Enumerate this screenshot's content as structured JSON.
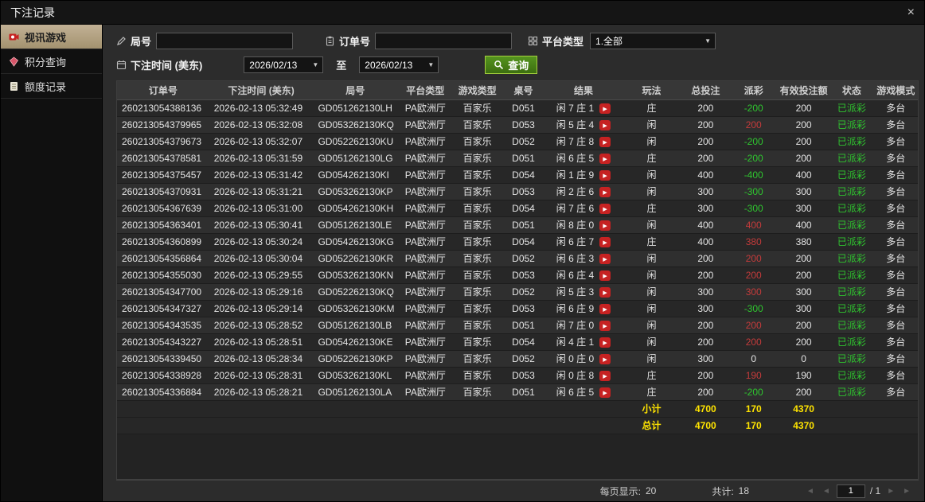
{
  "window": {
    "title": "下注记录"
  },
  "icons": {
    "close": "×",
    "dropdown_arrow": "▼",
    "play": "▶",
    "arrow_left": "◄",
    "arrow_right": "►"
  },
  "sidebar": {
    "items": [
      {
        "label": "视讯游戏"
      },
      {
        "label": "积分查询"
      },
      {
        "label": "额度记录"
      }
    ]
  },
  "filters": {
    "round_label": "局号",
    "round_value": "",
    "order_label": "订单号",
    "order_value": "",
    "platform_label": "平台类型",
    "platform_value": "1.全部",
    "time_label": "下注时间 (美东)",
    "date_from": "2026/02/13",
    "to_label": "至",
    "date_to": "2026/02/13",
    "query_label": "查询"
  },
  "table": {
    "headers": [
      "订单号",
      "下注时间 (美东)",
      "局号",
      "平台类型",
      "游戏类型",
      "桌号",
      "结果",
      "玩法",
      "总投注",
      "派彩",
      "有效投注额",
      "状态",
      "游戏模式"
    ],
    "rows": [
      {
        "order": "260213054388136",
        "time": "2026-02-13 05:32:49",
        "round": "GD051262130LH",
        "platform": "PA欧洲厅",
        "game": "百家乐",
        "table": "D051",
        "result": "闲 7 庄 1",
        "play": "庄",
        "bet": "200",
        "payout": "-200",
        "payout_sign": "neg",
        "valid": "200",
        "status": "已派彩",
        "mode": "多台"
      },
      {
        "order": "260213054379965",
        "time": "2026-02-13 05:32:08",
        "round": "GD053262130KQ",
        "platform": "PA欧洲厅",
        "game": "百家乐",
        "table": "D053",
        "result": "闲 5 庄 4",
        "play": "闲",
        "bet": "200",
        "payout": "200",
        "payout_sign": "pos",
        "valid": "200",
        "status": "已派彩",
        "mode": "多台"
      },
      {
        "order": "260213054379673",
        "time": "2026-02-13 05:32:07",
        "round": "GD052262130KU",
        "platform": "PA欧洲厅",
        "game": "百家乐",
        "table": "D052",
        "result": "闲 7 庄 8",
        "play": "闲",
        "bet": "200",
        "payout": "-200",
        "payout_sign": "neg",
        "valid": "200",
        "status": "已派彩",
        "mode": "多台"
      },
      {
        "order": "260213054378581",
        "time": "2026-02-13 05:31:59",
        "round": "GD051262130LG",
        "platform": "PA欧洲厅",
        "game": "百家乐",
        "table": "D051",
        "result": "闲 6 庄 5",
        "play": "庄",
        "bet": "200",
        "payout": "-200",
        "payout_sign": "neg",
        "valid": "200",
        "status": "已派彩",
        "mode": "多台"
      },
      {
        "order": "260213054375457",
        "time": "2026-02-13 05:31:42",
        "round": "GD054262130KI",
        "platform": "PA欧洲厅",
        "game": "百家乐",
        "table": "D054",
        "result": "闲 1 庄 9",
        "play": "闲",
        "bet": "400",
        "payout": "-400",
        "payout_sign": "neg",
        "valid": "400",
        "status": "已派彩",
        "mode": "多台"
      },
      {
        "order": "260213054370931",
        "time": "2026-02-13 05:31:21",
        "round": "GD053262130KP",
        "platform": "PA欧洲厅",
        "game": "百家乐",
        "table": "D053",
        "result": "闲 2 庄 6",
        "play": "闲",
        "bet": "300",
        "payout": "-300",
        "payout_sign": "neg",
        "valid": "300",
        "status": "已派彩",
        "mode": "多台"
      },
      {
        "order": "260213054367639",
        "time": "2026-02-13 05:31:00",
        "round": "GD054262130KH",
        "platform": "PA欧洲厅",
        "game": "百家乐",
        "table": "D054",
        "result": "闲 7 庄 6",
        "play": "庄",
        "bet": "300",
        "payout": "-300",
        "payout_sign": "neg",
        "valid": "300",
        "status": "已派彩",
        "mode": "多台"
      },
      {
        "order": "260213054363401",
        "time": "2026-02-13 05:30:41",
        "round": "GD051262130LE",
        "platform": "PA欧洲厅",
        "game": "百家乐",
        "table": "D051",
        "result": "闲 8 庄 0",
        "play": "闲",
        "bet": "400",
        "payout": "400",
        "payout_sign": "pos",
        "valid": "400",
        "status": "已派彩",
        "mode": "多台"
      },
      {
        "order": "260213054360899",
        "time": "2026-02-13 05:30:24",
        "round": "GD054262130KG",
        "platform": "PA欧洲厅",
        "game": "百家乐",
        "table": "D054",
        "result": "闲 6 庄 7",
        "play": "庄",
        "bet": "400",
        "payout": "380",
        "payout_sign": "pos",
        "valid": "380",
        "status": "已派彩",
        "mode": "多台"
      },
      {
        "order": "260213054356864",
        "time": "2026-02-13 05:30:04",
        "round": "GD052262130KR",
        "platform": "PA欧洲厅",
        "game": "百家乐",
        "table": "D052",
        "result": "闲 6 庄 3",
        "play": "闲",
        "bet": "200",
        "payout": "200",
        "payout_sign": "pos",
        "valid": "200",
        "status": "已派彩",
        "mode": "多台"
      },
      {
        "order": "260213054355030",
        "time": "2026-02-13 05:29:55",
        "round": "GD053262130KN",
        "platform": "PA欧洲厅",
        "game": "百家乐",
        "table": "D053",
        "result": "闲 6 庄 4",
        "play": "闲",
        "bet": "200",
        "payout": "200",
        "payout_sign": "pos",
        "valid": "200",
        "status": "已派彩",
        "mode": "多台"
      },
      {
        "order": "260213054347700",
        "time": "2026-02-13 05:29:16",
        "round": "GD052262130KQ",
        "platform": "PA欧洲厅",
        "game": "百家乐",
        "table": "D052",
        "result": "闲 5 庄 3",
        "play": "闲",
        "bet": "300",
        "payout": "300",
        "payout_sign": "pos",
        "valid": "300",
        "status": "已派彩",
        "mode": "多台"
      },
      {
        "order": "260213054347327",
        "time": "2026-02-13 05:29:14",
        "round": "GD053262130KM",
        "platform": "PA欧洲厅",
        "game": "百家乐",
        "table": "D053",
        "result": "闲 6 庄 9",
        "play": "闲",
        "bet": "300",
        "payout": "-300",
        "payout_sign": "neg",
        "valid": "300",
        "status": "已派彩",
        "mode": "多台"
      },
      {
        "order": "260213054343535",
        "time": "2026-02-13 05:28:52",
        "round": "GD051262130LB",
        "platform": "PA欧洲厅",
        "game": "百家乐",
        "table": "D051",
        "result": "闲 7 庄 0",
        "play": "闲",
        "bet": "200",
        "payout": "200",
        "payout_sign": "pos",
        "valid": "200",
        "status": "已派彩",
        "mode": "多台"
      },
      {
        "order": "260213054343227",
        "time": "2026-02-13 05:28:51",
        "round": "GD054262130KE",
        "platform": "PA欧洲厅",
        "game": "百家乐",
        "table": "D054",
        "result": "闲 4 庄 1",
        "play": "闲",
        "bet": "200",
        "payout": "200",
        "payout_sign": "pos",
        "valid": "200",
        "status": "已派彩",
        "mode": "多台"
      },
      {
        "order": "260213054339450",
        "time": "2026-02-13 05:28:34",
        "round": "GD052262130KP",
        "platform": "PA欧洲厅",
        "game": "百家乐",
        "table": "D052",
        "result": "闲 0 庄 0",
        "play": "闲",
        "bet": "300",
        "payout": "0",
        "payout_sign": "zero",
        "valid": "0",
        "status": "已派彩",
        "mode": "多台"
      },
      {
        "order": "260213054338928",
        "time": "2026-02-13 05:28:31",
        "round": "GD053262130KL",
        "platform": "PA欧洲厅",
        "game": "百家乐",
        "table": "D053",
        "result": "闲 0 庄 8",
        "play": "庄",
        "bet": "200",
        "payout": "190",
        "payout_sign": "pos",
        "valid": "190",
        "status": "已派彩",
        "mode": "多台"
      },
      {
        "order": "260213054336884",
        "time": "2026-02-13 05:28:21",
        "round": "GD051262130LA",
        "platform": "PA欧洲厅",
        "game": "百家乐",
        "table": "D051",
        "result": "闲 6 庄 5",
        "play": "庄",
        "bet": "200",
        "payout": "-200",
        "payout_sign": "neg",
        "valid": "200",
        "status": "已派彩",
        "mode": "多台"
      }
    ],
    "subtotal": {
      "label": "小计",
      "total_bet": "4700",
      "payout": "170",
      "valid_bet": "4370"
    },
    "total": {
      "label": "总计",
      "total_bet": "4700",
      "payout": "170",
      "valid_bet": "4370"
    }
  },
  "footer": {
    "per_page_label": "每页显示:",
    "per_page_value": "20",
    "total_label": "共计:",
    "total_value": "18",
    "page_value": "1",
    "page_total": "/ 1"
  }
}
